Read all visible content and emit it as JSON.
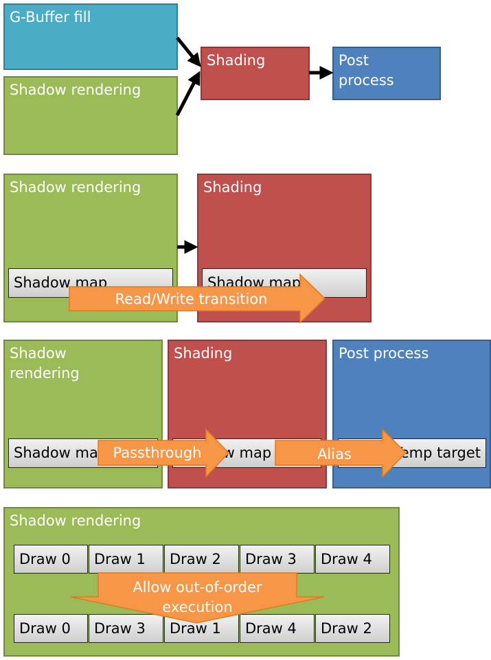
{
  "colors": {
    "gbuffer": "#4BACC6",
    "shadow": "#9BBB59",
    "shading": "#C0504D",
    "post": "#4F81BD",
    "arrow": "#F79646"
  },
  "row1": {
    "gbuffer": "G-Buffer fill",
    "shadow": "Shadow rendering",
    "shading": "Shading",
    "post": "Post\nprocess"
  },
  "row2": {
    "shadow": "Shadow rendering",
    "shading": "Shading",
    "shadow_map_a": "Shadow map",
    "shadow_map_b": "Shadow map",
    "arrow": "Read/Write transition"
  },
  "row3": {
    "shadow": "Shadow\nrendering",
    "shading": "Shading",
    "post": "Post process",
    "shadow_map_a": "Shadow map",
    "shadow_map_b": "Shadow map",
    "temp_target": "Temp target",
    "passthrough": "Passthrough",
    "alias": "Alias"
  },
  "row4": {
    "title": "Shadow rendering",
    "draws_before": [
      "Draw 0",
      "Draw 1",
      "Draw 2",
      "Draw 3",
      "Draw 4"
    ],
    "draws_after": [
      "Draw 0",
      "Draw 3",
      "Draw 1",
      "Draw 4",
      "Draw 2"
    ],
    "arrow": "Allow out-of-order\nexecution"
  }
}
